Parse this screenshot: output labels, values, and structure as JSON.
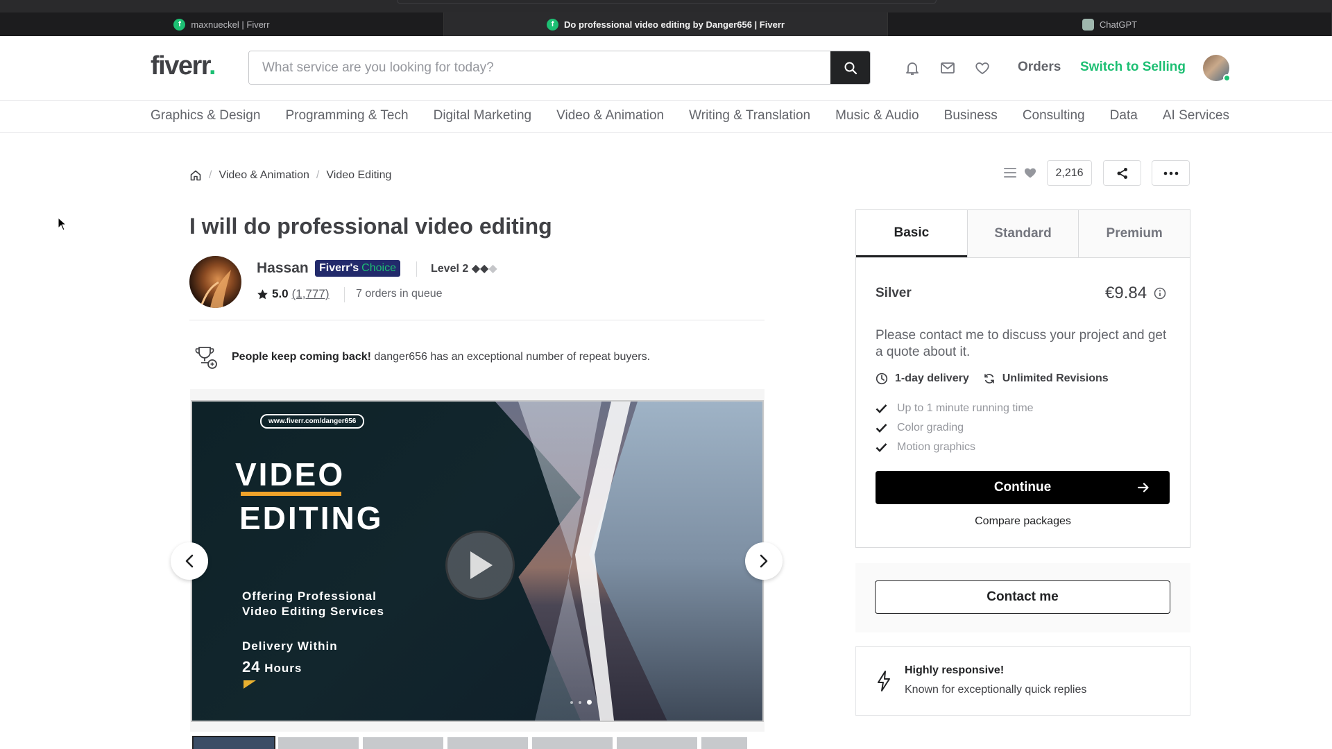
{
  "browser": {
    "tabs": [
      {
        "title": "maxnueckel | Fiverr",
        "favicon": "fiverr-icon"
      },
      {
        "title": "Do professional video editing by Danger656 | Fiverr",
        "favicon": "fiverr-icon",
        "active": true
      },
      {
        "title": "ChatGPT",
        "favicon": "chatgpt-icon"
      }
    ]
  },
  "header": {
    "logo": "fiverr",
    "logo_dot": ".",
    "search_placeholder": "What service are you looking for today?",
    "orders": "Orders",
    "switch_selling": "Switch to Selling"
  },
  "categories": [
    "Graphics & Design",
    "Programming & Tech",
    "Digital Marketing",
    "Video & Animation",
    "Writing & Translation",
    "Music & Audio",
    "Business",
    "Consulting",
    "Data",
    "AI Services"
  ],
  "breadcrumb": {
    "sep": "/",
    "items": [
      "Video & Animation",
      "Video Editing"
    ]
  },
  "toolbar": {
    "likes": "2,216"
  },
  "gig": {
    "title": "I will do professional video editing",
    "seller": "Hassan",
    "badge_part1": "Fiverr's",
    "badge_part2": "Choice",
    "level": "Level 2",
    "level_diamonds": "◆◆",
    "level_diamond_dim": "◆",
    "rating": "5.0",
    "rating_count": "(1,777)",
    "queue": "7 orders in queue",
    "repeat_bold": "People keep coming back!",
    "repeat_text": "danger656 has an exceptional number of repeat buyers."
  },
  "slide": {
    "url": "www.fiverr.com/danger656",
    "line1": "VIDEO",
    "line2": "EDITING",
    "offer1": "Offering Professional",
    "offer2": "Video Editing Services",
    "delivery1": "Delivery Within",
    "delivery_num": "24",
    "delivery_unit": "Hours"
  },
  "packages": {
    "tabs": [
      "Basic",
      "Standard",
      "Premium"
    ],
    "name": "Silver",
    "price": "€9.84",
    "description": "Please contact me to discuss your project and get a quote about it.",
    "delivery": "1-day delivery",
    "revisions": "Unlimited Revisions",
    "features": [
      "Up to 1 minute running time",
      "Color grading",
      "Motion graphics"
    ],
    "continue": "Continue",
    "compare": "Compare packages"
  },
  "contact": "Contact me",
  "responsive": {
    "title": "Highly responsive!",
    "subtitle": "Known for exceptionally quick replies"
  },
  "colors": {
    "brand_green": "#1dbf73",
    "text": "#404145",
    "choice_badge": "#222a6b"
  }
}
